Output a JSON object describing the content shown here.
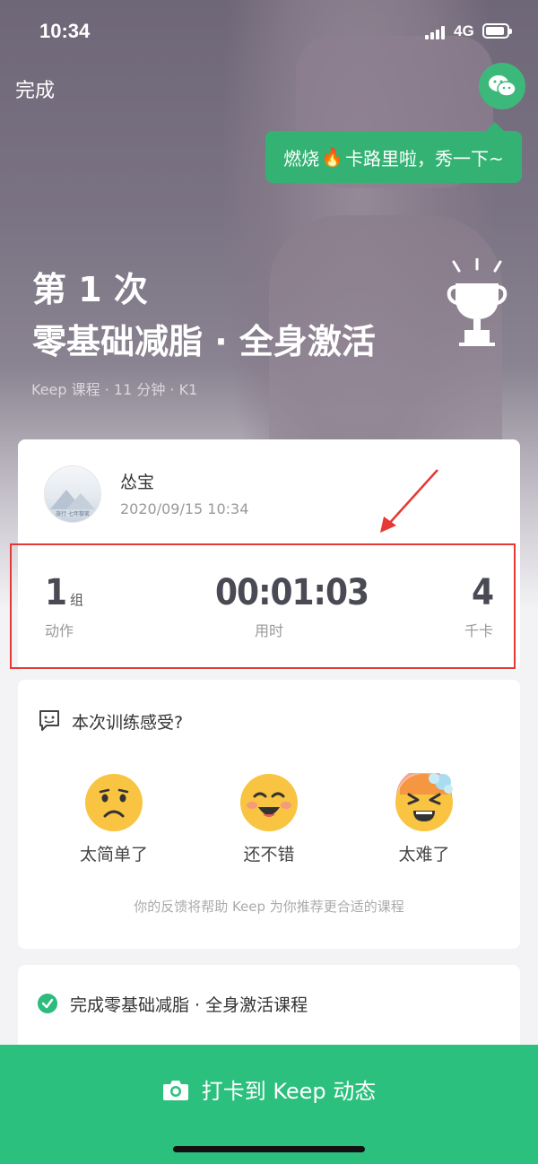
{
  "status_bar": {
    "time": "10:34",
    "network": "4G"
  },
  "nav": {
    "done_label": "完成",
    "share_icon": "wechat-icon",
    "share_tip_before": "燃烧",
    "share_tip_after": "卡路里啦，秀一下~"
  },
  "hero": {
    "count_title": "第 1 次",
    "course_title": "零基础减脂 · 全身激活",
    "meta": "Keep 课程 · 11 分钟 · K1"
  },
  "user": {
    "name": "怂宝",
    "datetime": "2020/09/15 10:34",
    "avatar_text": "旅行 七年黎茗"
  },
  "stats": [
    {
      "value": "1",
      "unit": "组",
      "label": "动作"
    },
    {
      "value": "00:01:03",
      "unit": "",
      "label": "用时"
    },
    {
      "value": "4",
      "unit": "",
      "label": "千卡"
    }
  ],
  "feedback": {
    "title": "本次训练感受?",
    "options": [
      {
        "label": "太简单了",
        "icon": "sad-face-icon"
      },
      {
        "label": "还不错",
        "icon": "happy-face-icon"
      },
      {
        "label": "太难了",
        "icon": "exhausted-face-icon"
      }
    ],
    "hint": "你的反馈将帮助 Keep 为你推荐更合适的课程"
  },
  "completed": {
    "text": "完成零基础减脂 · 全身激活课程"
  },
  "cta": {
    "label": "打卡到 Keep 动态"
  },
  "colors": {
    "brand_green": "#2cc07e",
    "wechat_green": "#3cb97a",
    "highlight_red": "#e53935"
  }
}
